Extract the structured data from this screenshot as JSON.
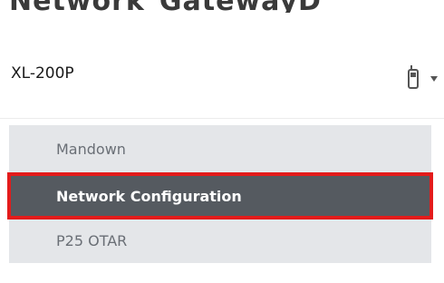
{
  "header": {
    "partial_title": "Network_GatewayD"
  },
  "device": {
    "name": "XL-200P",
    "icon": "radio-handset-icon",
    "dropdown_icon": "caret-down-icon"
  },
  "menu": {
    "items": [
      {
        "label": "Mandown",
        "selected": false
      },
      {
        "label": "Network Configuration",
        "selected": true
      },
      {
        "label": "P25 OTAR",
        "selected": false
      }
    ]
  },
  "colors": {
    "selected_bg": "#555a60",
    "highlight_border": "#e31b1b",
    "item_bg": "#e4e6e9",
    "item_text": "#6a6f76"
  }
}
